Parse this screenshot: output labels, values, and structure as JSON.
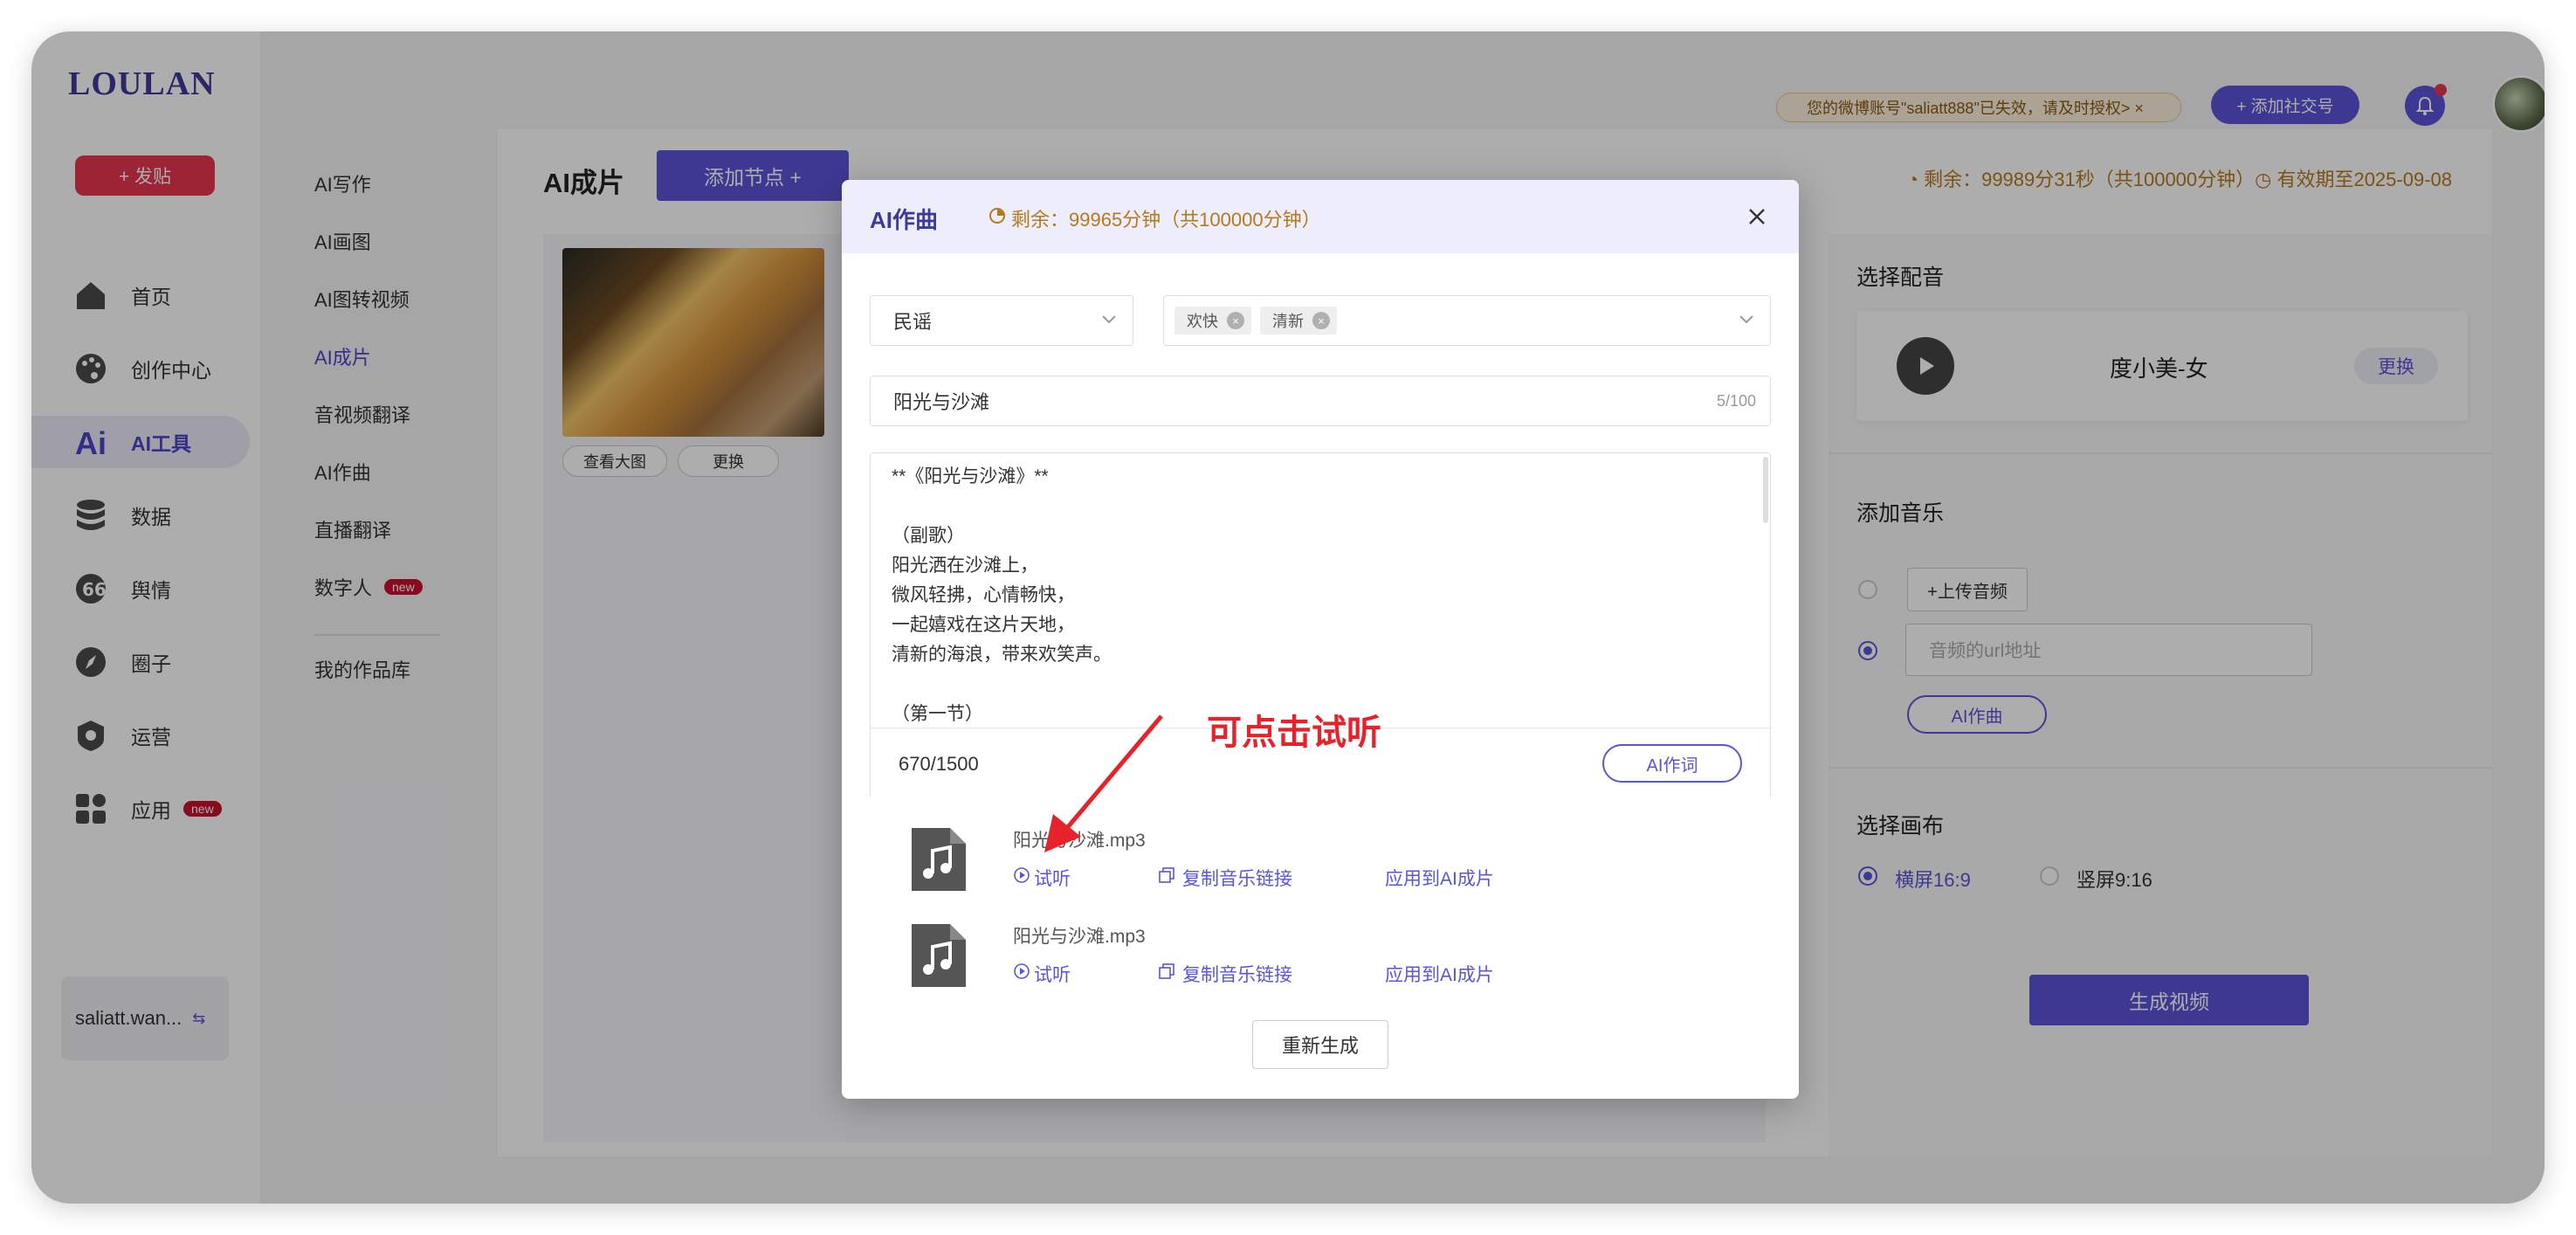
{
  "sidebar": {
    "logo": "LOULAN",
    "post_button": "+ 发贴",
    "items": [
      {
        "label": "首页",
        "icon": "home-icon"
      },
      {
        "label": "创作中心",
        "icon": "palette-icon"
      },
      {
        "label": "AI工具",
        "icon": "ai-icon"
      },
      {
        "label": "数据",
        "icon": "database-icon"
      },
      {
        "label": "舆情",
        "icon": "sentiment-icon"
      },
      {
        "label": "圈子",
        "icon": "compass-icon"
      },
      {
        "label": "运营",
        "icon": "operation-icon"
      },
      {
        "label": "应用",
        "icon": "apps-icon",
        "badge": "new"
      }
    ],
    "account": "saliatt.wan...",
    "switch_icon": "⇆"
  },
  "submenu": {
    "items": [
      "AI写作",
      "AI画图",
      "AI图转视频",
      "AI成片",
      "音视频翻译",
      "AI作曲",
      "直播翻译",
      "数字人"
    ],
    "digital_badge": "new",
    "library": "我的作品库"
  },
  "header": {
    "warning": "您的微博账号\"saliatt888\"已失效，请及时授权> ×",
    "add_social": "+ 添加社交号"
  },
  "main": {
    "title": "AI成片",
    "add_node": "添加节点 +",
    "quota": "◔ 剩余：99989分31秒（共100000分钟）◷ 有效期至2025-09-08",
    "scene_buttons": [
      "查看大图",
      "更换"
    ]
  },
  "right_panel": {
    "voice_title": "选择配音",
    "voice_name": "度小美-女",
    "voice_change": "更换",
    "music_title": "添加音乐",
    "upload": "+上传音频",
    "url_placeholder": "音频的url地址",
    "ai_compose": "AI作曲",
    "canvas_title": "选择画布",
    "landscape": "横屏16:9",
    "portrait": "竖屏9:16",
    "generate": "生成视频"
  },
  "modal": {
    "title": "AI作曲",
    "quota": "剩余：99965分钟（共100000分钟）",
    "genre": "民谣",
    "tags": [
      "欢快",
      "清新"
    ],
    "song_title": "阳光与沙滩",
    "song_title_count": "5/100",
    "lyrics": "**《阳光与沙滩》**\n\n（副歌）\n阳光洒在沙滩上，\n微风轻拂，心情畅快，\n一起嬉戏在这片天地，\n清新的海浪，带来欢笑声。\n\n（第一节）",
    "lyrics_count": "670/1500",
    "ai_lyric": "AI作词",
    "songs": [
      {
        "name": "阳光与沙滩.mp3",
        "listen": "试听",
        "copy": "复制音乐链接",
        "apply": "应用到AI成片"
      },
      {
        "name": "阳光与沙滩.mp3",
        "listen": "试听",
        "copy": "复制音乐链接",
        "apply": "应用到AI成片"
      }
    ],
    "regenerate": "重新生成"
  },
  "annotation": "可点击试听"
}
